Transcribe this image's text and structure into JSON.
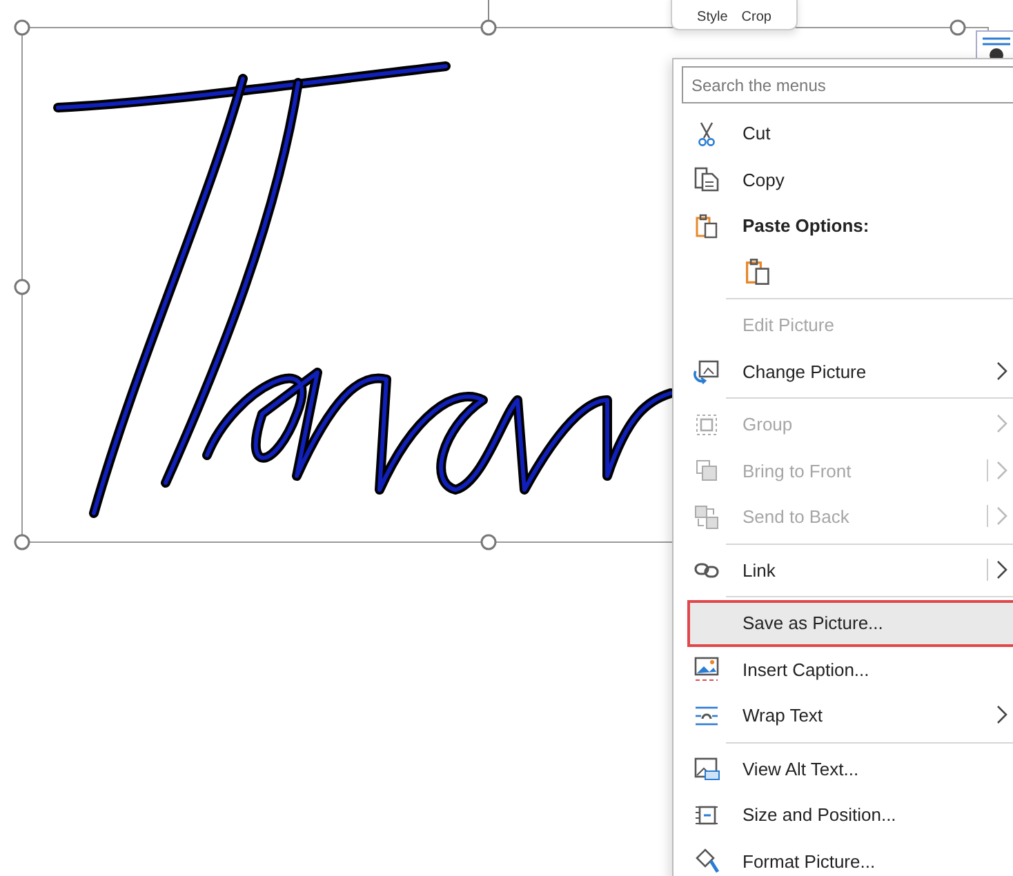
{
  "toolbar": {
    "labels": [
      "Style",
      "Crop"
    ]
  },
  "menu": {
    "search": {
      "placeholder": "Search the menus"
    },
    "items": [
      {
        "kind": "item",
        "label": "Cut",
        "disabled": false,
        "submenu": false,
        "split": false,
        "selected": false
      },
      {
        "kind": "item",
        "label": "Copy",
        "disabled": false,
        "submenu": false,
        "split": false,
        "selected": false
      },
      {
        "kind": "header",
        "label": "Paste Options:"
      },
      {
        "kind": "paste_options"
      },
      {
        "kind": "separator"
      },
      {
        "kind": "item",
        "label": "Edit Picture",
        "disabled": true,
        "submenu": false,
        "split": false,
        "selected": false
      },
      {
        "kind": "item",
        "label": "Change Picture",
        "disabled": false,
        "submenu": true,
        "split": false,
        "selected": false
      },
      {
        "kind": "separator"
      },
      {
        "kind": "item",
        "label": "Group",
        "disabled": true,
        "submenu": true,
        "split": false,
        "selected": false
      },
      {
        "kind": "item",
        "label": "Bring to Front",
        "disabled": true,
        "submenu": true,
        "split": true,
        "selected": false
      },
      {
        "kind": "item",
        "label": "Send to Back",
        "disabled": true,
        "submenu": true,
        "split": true,
        "selected": false
      },
      {
        "kind": "separator"
      },
      {
        "kind": "item",
        "label": "Link",
        "disabled": false,
        "submenu": true,
        "split": true,
        "selected": false
      },
      {
        "kind": "separator"
      },
      {
        "kind": "item",
        "label": "Save as Picture...",
        "disabled": false,
        "submenu": false,
        "split": false,
        "selected": true
      },
      {
        "kind": "item",
        "label": "Insert Caption...",
        "disabled": false,
        "submenu": false,
        "split": false,
        "selected": false
      },
      {
        "kind": "item",
        "label": "Wrap Text",
        "disabled": false,
        "submenu": true,
        "split": false,
        "selected": false
      },
      {
        "kind": "separator"
      },
      {
        "kind": "item",
        "label": "View Alt Text...",
        "disabled": false,
        "submenu": false,
        "split": false,
        "selected": false
      },
      {
        "kind": "item",
        "label": "Size and Position...",
        "disabled": false,
        "submenu": false,
        "split": false,
        "selected": false
      },
      {
        "kind": "item",
        "label": "Format Picture...",
        "disabled": false,
        "submenu": false,
        "split": false,
        "selected": false
      }
    ]
  }
}
